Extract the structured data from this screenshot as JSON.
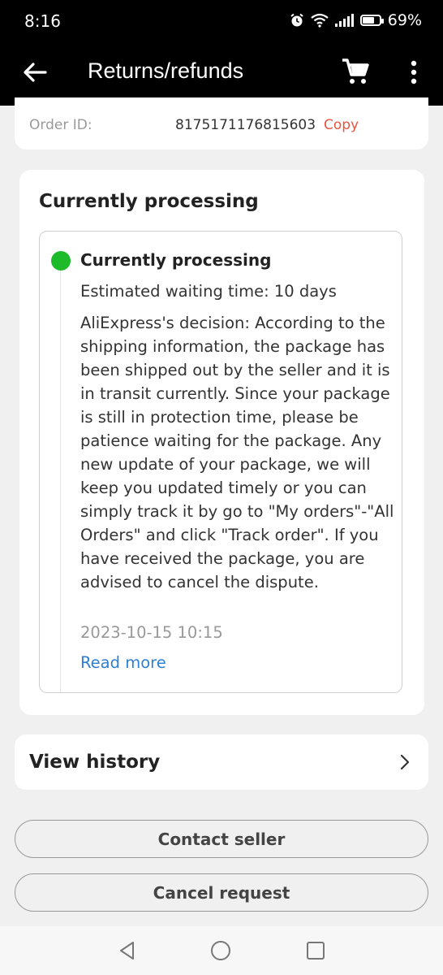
{
  "status_bar": {
    "time": "8:16",
    "battery": "69%",
    "battery_level": 0.69,
    "icons": [
      "alarm-icon",
      "wifi-icon",
      "signal-icon",
      "battery-icon"
    ]
  },
  "app_bar": {
    "title": "Returns/refunds",
    "icons": [
      "back-arrow-icon",
      "cart-icon",
      "more-vert-icon"
    ]
  },
  "order": {
    "label": "Order ID:",
    "value": "8175171176815603",
    "copy_label": "Copy"
  },
  "processing_card": {
    "heading": "Currently processing",
    "status_title": "Currently processing",
    "status_color": "#1dbb2a",
    "wait_text": "Estimated waiting time: 10 days",
    "decision_text": "AliExpress's decision: According to the shipping information, the package has been shipped out by the seller and it is in transit currently. Since your package is still in protection time, please be patience waiting for the package. Any new update of your package, we will keep you updated timely or you can simply track it by go to \"My orders\"-\"All Orders\" and click \"Track order\". If you have received the package, you are advised to cancel the dispute.",
    "date": "2023-10-15 10:15",
    "read_more": "Read more"
  },
  "history": {
    "label": "View history"
  },
  "actions": {
    "contact_seller": "Contact seller",
    "cancel_request": "Cancel request"
  },
  "colors": {
    "accent_red": "#e8543e",
    "link_blue": "#2e7fd3",
    "status_green": "#1dbb2a"
  }
}
